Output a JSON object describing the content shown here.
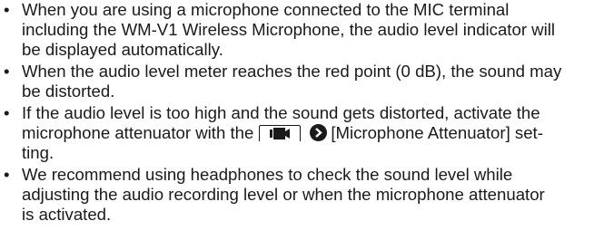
{
  "notes": [
    {
      "lines": [
        "When you are using a microphone connected to the MIC terminal",
        "including the WM-V1 Wireless Microphone, the audio level indicator will",
        "be displayed automatically."
      ]
    },
    {
      "lines": [
        "When the audio level meter reaches the red point (0 dB), the sound may",
        "be distorted."
      ]
    },
    {
      "line1": "If the audio level is too high and the sound gets distorted, activate the",
      "line2_before": "microphone attenuator with the",
      "line2_after": "[Microphone Attenuator] set-",
      "line3": "ting.",
      "menu_icon": "movie-camera-menu-icon",
      "arrow_icon": "chevron-right-circle-icon"
    },
    {
      "lines": [
        "We recommend using headphones to check the sound level while",
        "adjusting the audio recording level or when the microphone attenuator",
        "is activated."
      ]
    }
  ],
  "bullet_char": "•"
}
